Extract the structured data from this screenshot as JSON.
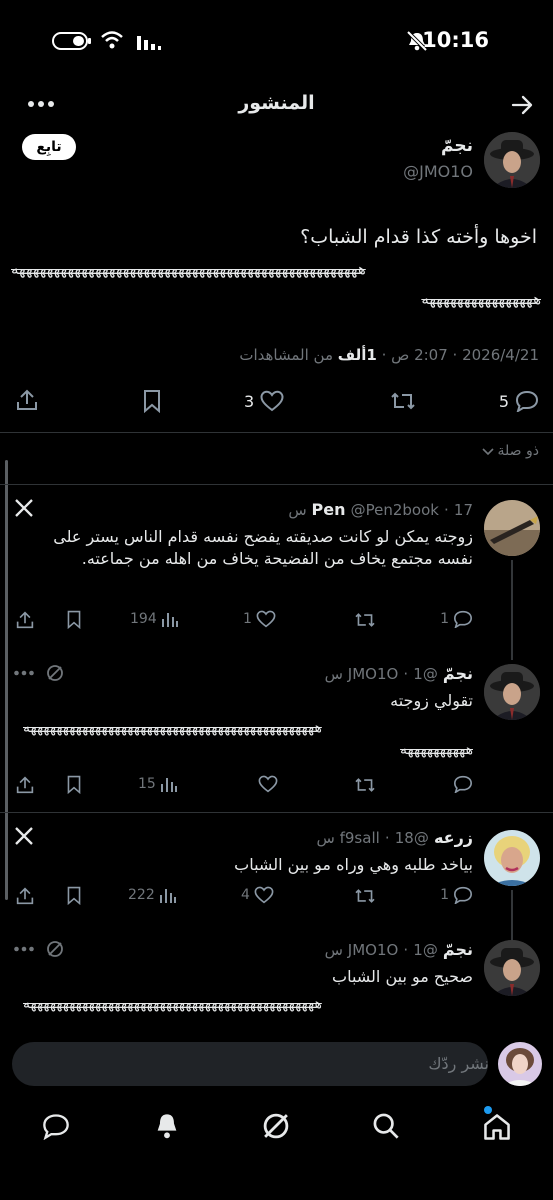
{
  "status": {
    "time": "10:16"
  },
  "header": {
    "title": "المنشور"
  },
  "author": {
    "name": "نجمّ",
    "handle": "@JMO1O",
    "follow_label": "تابِع"
  },
  "post": {
    "text": "اخوها وأخته كذا قدام الشباب؟",
    "laugh_line1": "ههههههههههههههههههههههههههههههههههههههههههههههههههه",
    "laugh_line2": "ههههههههههههههههه",
    "date": "2026/4/21",
    "time": "2:07 ص",
    "views_count": "1ألف",
    "views_label": "من المشاهدات",
    "replies": "5",
    "likes": "3"
  },
  "thread_label": "ذو صلة",
  "replies": [
    {
      "name": "Pen",
      "handle": "@Pen2book",
      "time": "17 س",
      "text": "زوجته يمكن لو كانت صديقته يفضح نفسه قدام الناس يستر على نفسه مجتمع يخاف من الفضيحة يخاف من اهله من جماعته.",
      "replies": "1",
      "likes": "1",
      "views": "194"
    },
    {
      "name": "نجمّ",
      "handle": "@JMO1O",
      "time": "1 س",
      "text": "تقولي زوجته",
      "laugh_line1": "هههههههههههههههههههههههههههههههههههههههههههههه",
      "laugh_line2": "ههههههههههه",
      "views": "15"
    },
    {
      "name": "زرعه",
      "handle": "@f9sall",
      "time": "18 س",
      "text": "بياخد طلبه وهي وراه مو بين الشباب",
      "replies": "1",
      "likes": "4",
      "views": "222"
    },
    {
      "name": "نجمّ",
      "handle": "@JMO1O",
      "time": "1 س",
      "text": "صحيح مو بين الشباب",
      "laugh_line1": "هههههههههههههههههههههههههههههههههههههههههههههه"
    }
  ],
  "composer": {
    "placeholder": "نشر ردّك"
  },
  "colors": {
    "background": "#000000",
    "text": "#e7e9ea",
    "muted": "#71767b",
    "divider": "#2f3336",
    "accent": "#1d9bf0"
  }
}
